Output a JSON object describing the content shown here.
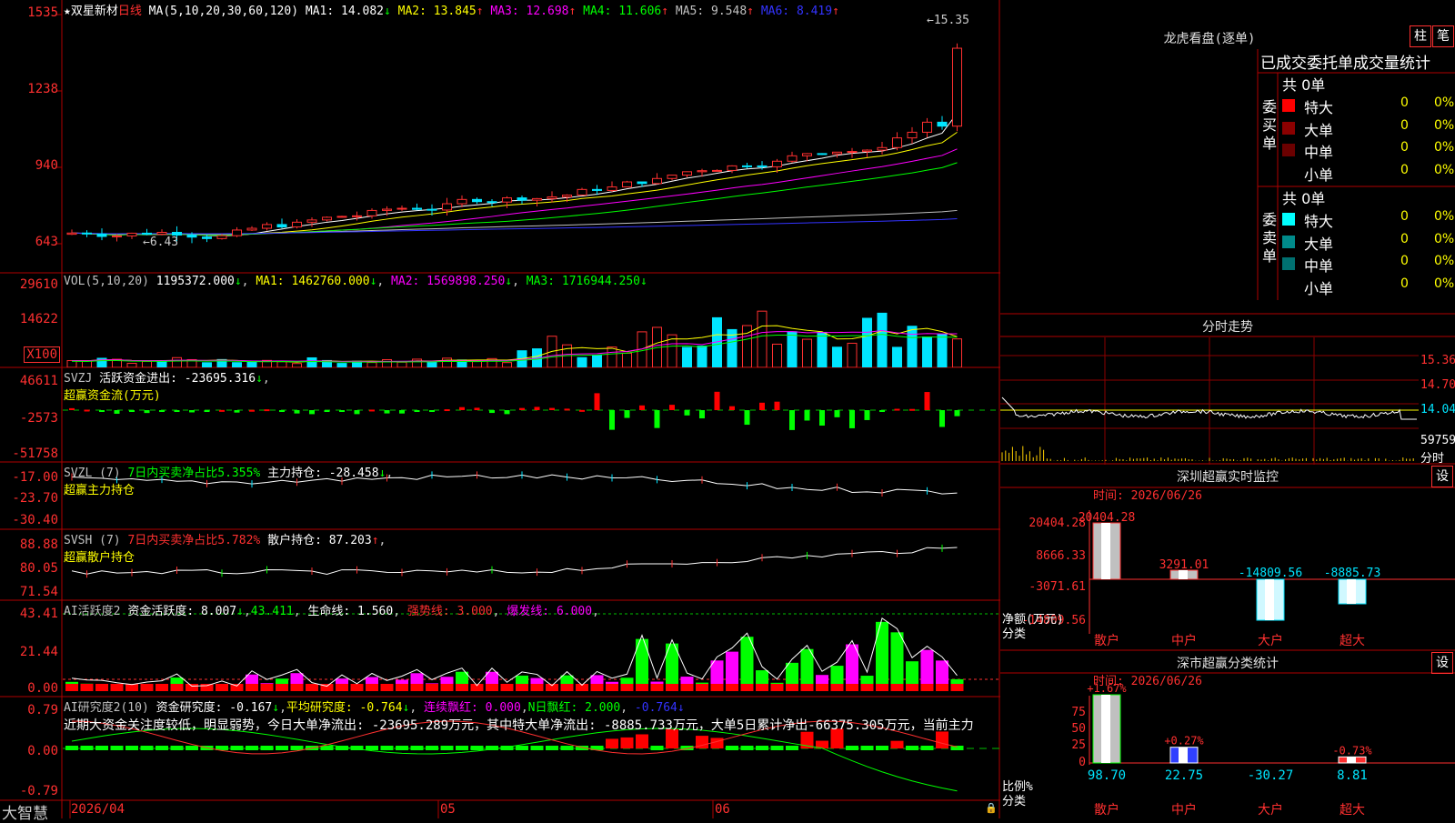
{
  "stock": {
    "name": "★双星新材",
    "period": "日线",
    "ma_params": "MA(5,10,20,30,60,120)",
    "ma": [
      {
        "label": "MA1: 14.082",
        "arrow": "↓",
        "color": "#ffffff"
      },
      {
        "label": "MA2: 13.845",
        "arrow": "↑",
        "color": "#ffff00"
      },
      {
        "label": "MA3: 12.698",
        "arrow": "↑",
        "color": "#ff00ff"
      },
      {
        "label": "MA4: 11.606",
        "arrow": "↑",
        "color": "#00ff00"
      },
      {
        "label": "MA5: 9.548",
        "arrow": "↑",
        "color": "#c0c0c0"
      },
      {
        "label": "MA6: 8.419",
        "arrow": "↑",
        "color": "#3333ff"
      }
    ],
    "high_mark": "15.35",
    "low_mark": "6.43"
  },
  "price_axis": [
    "1535",
    "1238",
    "940",
    "643"
  ],
  "vol": {
    "header": "VOL(5,10,20)",
    "value": "1195372.000",
    "ma1": "MA1: 1462760.000",
    "ma2": "MA2: 1569898.250",
    "ma3": "MA3: 1716944.250",
    "axis": [
      "29610",
      "14622",
      "X100"
    ]
  },
  "svzj": {
    "name": "SVZJ",
    "text": "活跃资金进出: -23695.316",
    "sub": "超赢资金流(万元)",
    "axis": [
      "46611",
      "-2573",
      "-51758"
    ]
  },
  "svzl": {
    "name": "SVZL (7)",
    "text": "7日内买卖净占比5.355%",
    "text2": "主力持仓: -28.458",
    "sub": "超赢主力持仓",
    "axis": [
      "-17.00",
      "-23.70",
      "-30.40"
    ]
  },
  "svsh": {
    "name": "SVSH (7)",
    "text": "7日内买卖净占比5.782%",
    "text2": "散户持仓: 87.203",
    "sub": "超赢散户持仓",
    "axis": [
      "88.88",
      "80.05",
      "71.54"
    ]
  },
  "ai1": {
    "name": "AI活跃度2",
    "text": "资金活跃度: 8.007",
    "v2": "43.411",
    "v3": "生命线: 1.560",
    "v4": "强势线: 3.000",
    "v5": "爆发线: 6.000",
    "axis": [
      "43.41",
      "21.44",
      "0.00"
    ]
  },
  "ai2": {
    "name": "AI研究度2(10)",
    "text": "资金研究度: -0.167",
    "v2": "平均研究度: -0.764",
    "v3": "连续飘红: 0.000",
    "v4": "N日飘红: 2.000",
    "v5": "-0.764",
    "commentary": "近期大资金关注度较低，明显弱势，今日大单净流出: -23695.289万元，其中特大单净流出: -8885.733万元，大单5日累计净出-66375.305万元，当前主力",
    "axis": [
      "0.79",
      "0.00",
      "-0.79"
    ]
  },
  "dates": [
    "2026/04",
    "05",
    "06"
  ],
  "brand": "大智慧",
  "longhu": {
    "title": "龙虎看盘(逐单)",
    "btn1": "柱",
    "btn2": "笔",
    "subtitle": "已成交委托单成交量统计",
    "buy_label": "委买单",
    "sell_label": "委卖单",
    "buy_total": "共 0单",
    "sell_total": "共 0单",
    "buy_rows": [
      {
        "label": "特大",
        "n": "0",
        "pct": "0%",
        "color": "#ff0000"
      },
      {
        "label": "大单",
        "n": "0",
        "pct": "0%",
        "color": "#8b0000"
      },
      {
        "label": "中单",
        "n": "0",
        "pct": "0%",
        "color": "#6b0000"
      },
      {
        "label": "小单",
        "n": "0",
        "pct": "0%",
        "color": "#000000"
      }
    ],
    "sell_rows": [
      {
        "label": "特大",
        "n": "0",
        "pct": "0%",
        "color": "#00ffff"
      },
      {
        "label": "大单",
        "n": "0",
        "pct": "0%",
        "color": "#008b8b"
      },
      {
        "label": "中单",
        "n": "0",
        "pct": "0%",
        "color": "#007070"
      },
      {
        "label": "小单",
        "n": "0",
        "pct": "0%",
        "color": "#000000"
      }
    ]
  },
  "intraday": {
    "title": "分时走势",
    "axis": [
      "15.36",
      "14.70",
      "14.04",
      "59759",
      "分时"
    ]
  },
  "sz_monitor": {
    "title": "深圳超赢实时监控",
    "btn": "设",
    "time": "时间: 2026/06/26",
    "axis": [
      "20404.28",
      "8666.33",
      "-3071.61",
      "-14809.56"
    ],
    "ylabel1": "净额(万元)",
    "ylabel2": "分类",
    "bars": [
      {
        "cat": "散户",
        "val": "20404.28"
      },
      {
        "cat": "中户",
        "val": "3291.01"
      },
      {
        "cat": "大户",
        "val": "-14809.56"
      },
      {
        "cat": "超大",
        "val": "-8885.73"
      }
    ]
  },
  "sz_class": {
    "title": "深市超赢分类统计",
    "btn": "设",
    "time": "时间: 2026/06/26",
    "axis": [
      "75",
      "50",
      "25",
      "0"
    ],
    "ylabel1": "比例%",
    "ylabel2": "分类",
    "bars": [
      {
        "cat": "散户",
        "top": "+1.67%",
        "val": "98.70"
      },
      {
        "cat": "中户",
        "top": "+0.27%",
        "val": "22.75"
      },
      {
        "cat": "大户",
        "top": "",
        "val": "-30.27"
      },
      {
        "cat": "超大",
        "top": "-0.73%",
        "val": "8.81"
      }
    ]
  }
}
